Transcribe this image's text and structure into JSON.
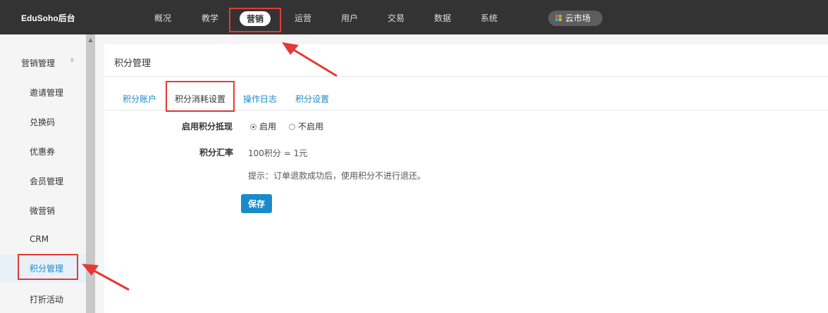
{
  "header": {
    "brand": "EduSoho后台",
    "nav": [
      {
        "label": "概况"
      },
      {
        "label": "教学"
      },
      {
        "label": "营销",
        "active": true
      },
      {
        "label": "运营"
      },
      {
        "label": "用户"
      },
      {
        "label": "交易"
      },
      {
        "label": "数据"
      },
      {
        "label": "系统"
      }
    ],
    "cloud_market": "云市场"
  },
  "sidebar": {
    "group": "营销管理",
    "items": [
      {
        "label": "邀请管理"
      },
      {
        "label": "兑换码"
      },
      {
        "label": "优惠券"
      },
      {
        "label": "会员管理"
      },
      {
        "label": "微营销"
      },
      {
        "label": "CRM"
      },
      {
        "label": "积分管理",
        "active": true
      },
      {
        "label": "打折活动"
      }
    ]
  },
  "main": {
    "title": "积分管理",
    "tabs": [
      {
        "label": "积分账户"
      },
      {
        "label": "积分消耗设置",
        "active": true
      },
      {
        "label": "操作日志"
      },
      {
        "label": "积分设置"
      }
    ],
    "form": {
      "enable_label": "启用积分抵现",
      "option_on": "启用",
      "option_off": "不启用",
      "selected": "启用",
      "rate_label": "积分汇率",
      "rate_value": "100积分 = 1元",
      "hint": "提示：订单退款成功后，使用积分不进行退还。",
      "save_label": "保存"
    }
  },
  "colors": {
    "topbar": "#333333",
    "accent": "#1a8bc9",
    "highlight": "#e53935"
  }
}
